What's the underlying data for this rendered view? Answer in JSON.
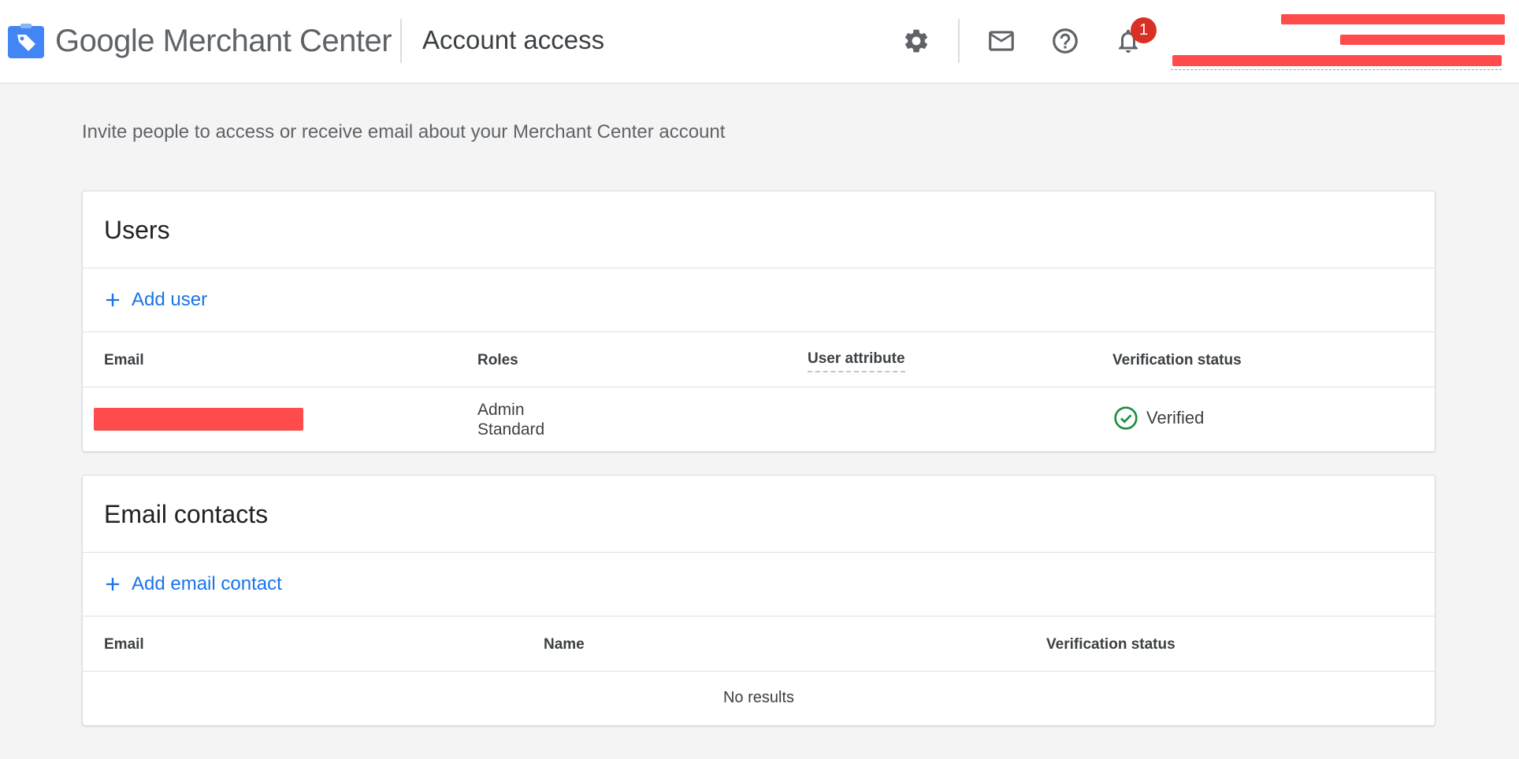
{
  "header": {
    "brand_google": "Google",
    "brand_product": "Merchant Center",
    "page_title": "Account access",
    "notification_count": "1",
    "icons": [
      "tag-logo-icon",
      "settings-icon",
      "mail-icon",
      "help-icon",
      "bell-icon"
    ]
  },
  "intro": "Invite people to access or receive email about your Merchant Center account",
  "users": {
    "title": "Users",
    "add_label": "Add user",
    "columns": {
      "email": "Email",
      "roles": "Roles",
      "user_attribute": "User attribute",
      "verification_status": "Verification status"
    },
    "rows": [
      {
        "role_1": "Admin",
        "role_2": "Standard",
        "status": "Verified"
      }
    ]
  },
  "contacts": {
    "title": "Email contacts",
    "add_label": "Add email contact",
    "columns": {
      "email": "Email",
      "name": "Name",
      "verification_status": "Verification status"
    },
    "empty_text": "No results"
  },
  "colors": {
    "accent": "#1a73e8",
    "verified": "#1e8e3e",
    "badge": "#d93025",
    "redaction": "#ff4b4b"
  }
}
